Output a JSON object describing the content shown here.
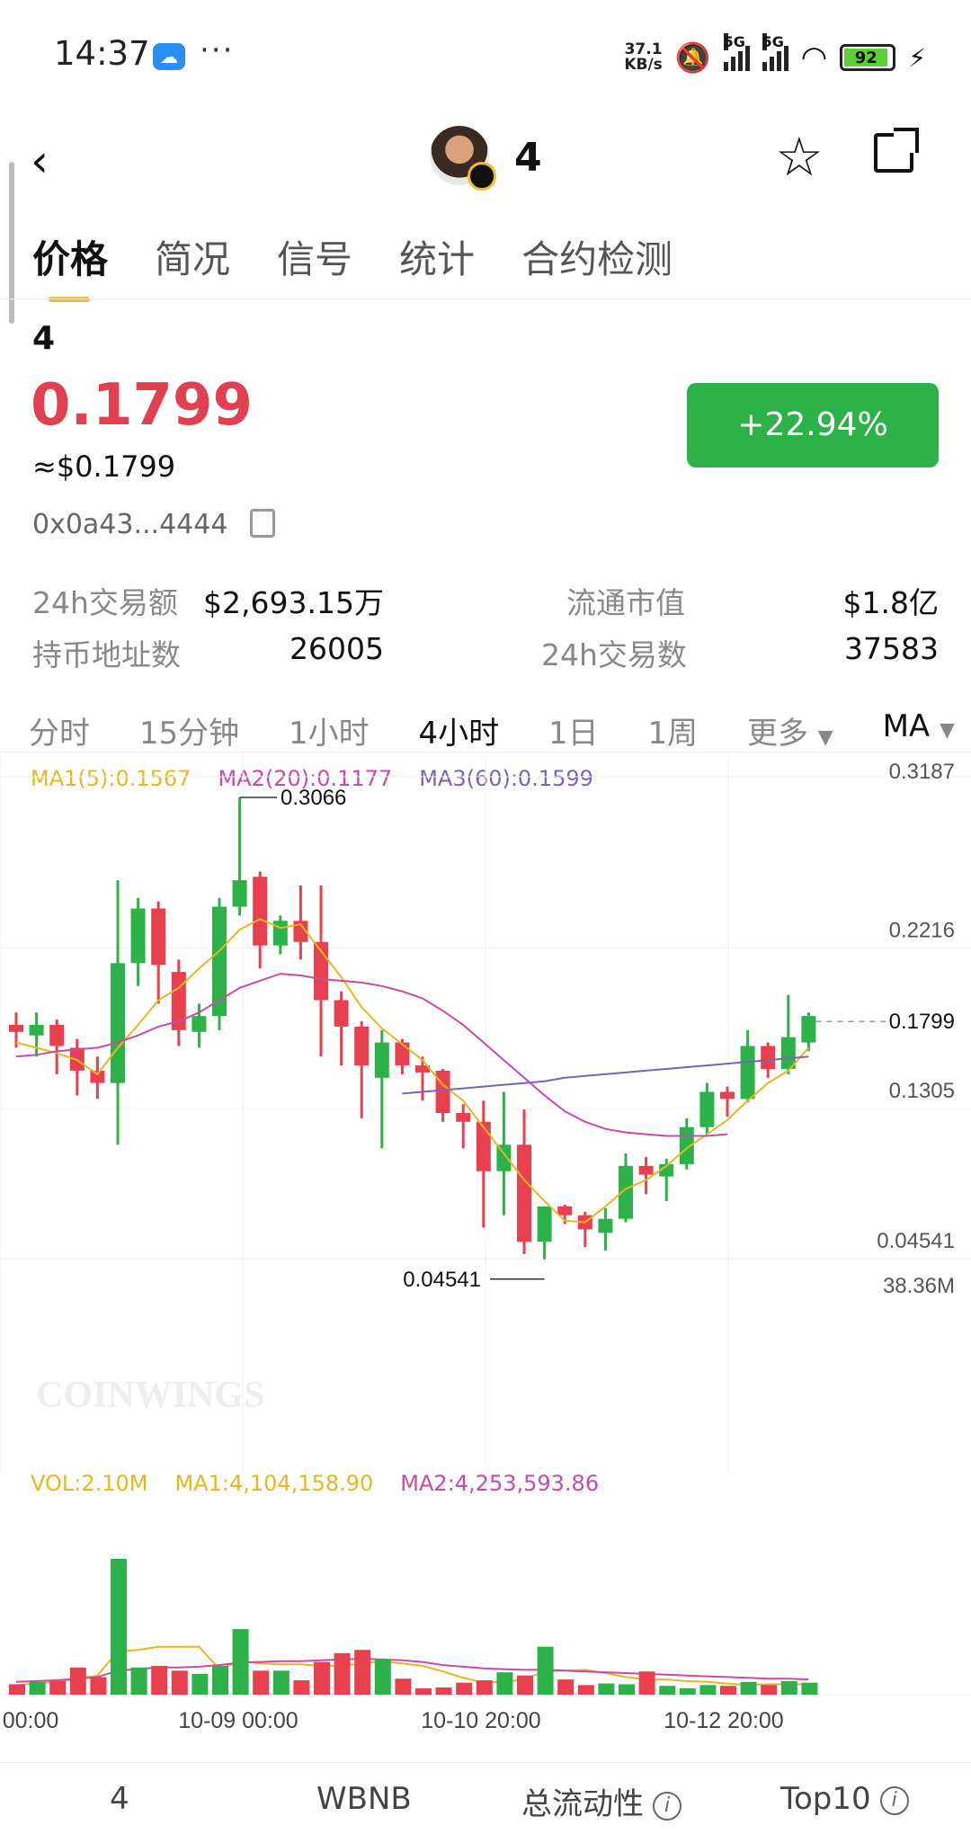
{
  "status_bar": {
    "time": "14:37",
    "speed_value": "37.1",
    "speed_unit": "KB/s",
    "net1": "5G",
    "net2": "5G",
    "battery": "92"
  },
  "header": {
    "title": "4"
  },
  "tabs": [
    "价格",
    "简况",
    "信号",
    "统计",
    "合约检测"
  ],
  "token": {
    "symbol": "4",
    "price": "0.1799",
    "usd_price": "≈$0.1799",
    "change": "+22.94%",
    "address": "0x0a43...4444"
  },
  "stats": {
    "vol24_label": "24h交易额",
    "vol24_value": "$2,693.15万",
    "mcap_label": "流通市值",
    "mcap_value": "$1.8亿",
    "holders_label": "持币地址数",
    "holders_value": "26005",
    "tx24_label": "24h交易数",
    "tx24_value": "37583"
  },
  "timeframes": [
    "分时",
    "15分钟",
    "1小时",
    "4小时",
    "1日",
    "1周",
    "更多",
    "MA"
  ],
  "chart_legend": {
    "ma1": "MA1(5):0.1567",
    "ma2": "MA2(20):0.1177",
    "ma3": "MA3(60):0.1599"
  },
  "vol_legend": {
    "vol": "VOL:2.10M",
    "ma1": "MA1:4,104,158.90",
    "ma2": "MA2:4,253,593.86"
  },
  "watermark": "COINWINGS",
  "colors": {
    "up": "#2db24a",
    "down": "#e8404f",
    "ma1": "#e6b81e",
    "ma2": "#c94aa8",
    "ma3": "#7a62b8",
    "accent": "#f3ba2f"
  },
  "chart_data": {
    "type": "candlestick",
    "y_ticks": [
      "0.3187",
      "0.2216",
      "0.1305",
      "0.04541"
    ],
    "ylim": [
      0.04541,
      0.3187
    ],
    "current_price": "0.1799",
    "high_label": "0.3066",
    "low_label": "0.04541",
    "vol_max_label": "38.36M",
    "x_ticks": [
      "00:00",
      "10-09 00:00",
      "10-10 20:00",
      "10-12 20:00"
    ],
    "candles": [
      {
        "o": 0.178,
        "h": 0.185,
        "l": 0.165,
        "c": 0.174
      },
      {
        "o": 0.172,
        "h": 0.185,
        "l": 0.16,
        "c": 0.178
      },
      {
        "o": 0.178,
        "h": 0.181,
        "l": 0.15,
        "c": 0.166
      },
      {
        "o": 0.165,
        "h": 0.17,
        "l": 0.138,
        "c": 0.152
      },
      {
        "o": 0.152,
        "h": 0.16,
        "l": 0.136,
        "c": 0.145
      },
      {
        "o": 0.145,
        "h": 0.26,
        "l": 0.11,
        "c": 0.213
      },
      {
        "o": 0.213,
        "h": 0.25,
        "l": 0.2,
        "c": 0.244
      },
      {
        "o": 0.244,
        "h": 0.248,
        "l": 0.19,
        "c": 0.212
      },
      {
        "o": 0.208,
        "h": 0.215,
        "l": 0.166,
        "c": 0.175
      },
      {
        "o": 0.174,
        "h": 0.19,
        "l": 0.165,
        "c": 0.183
      },
      {
        "o": 0.183,
        "h": 0.25,
        "l": 0.175,
        "c": 0.245
      },
      {
        "o": 0.245,
        "h": 0.307,
        "l": 0.24,
        "c": 0.26
      },
      {
        "o": 0.262,
        "h": 0.265,
        "l": 0.21,
        "c": 0.223
      },
      {
        "o": 0.223,
        "h": 0.24,
        "l": 0.218,
        "c": 0.237
      },
      {
        "o": 0.237,
        "h": 0.257,
        "l": 0.215,
        "c": 0.225
      },
      {
        "o": 0.225,
        "h": 0.257,
        "l": 0.16,
        "c": 0.192
      },
      {
        "o": 0.192,
        "h": 0.197,
        "l": 0.155,
        "c": 0.177
      },
      {
        "o": 0.177,
        "h": 0.18,
        "l": 0.125,
        "c": 0.155
      },
      {
        "o": 0.148,
        "h": 0.175,
        "l": 0.108,
        "c": 0.168
      },
      {
        "o": 0.168,
        "h": 0.17,
        "l": 0.15,
        "c": 0.155
      },
      {
        "o": 0.155,
        "h": 0.16,
        "l": 0.135,
        "c": 0.151
      },
      {
        "o": 0.152,
        "h": 0.153,
        "l": 0.123,
        "c": 0.128
      },
      {
        "o": 0.128,
        "h": 0.133,
        "l": 0.108,
        "c": 0.123
      },
      {
        "o": 0.123,
        "h": 0.135,
        "l": 0.063,
        "c": 0.095
      },
      {
        "o": 0.095,
        "h": 0.14,
        "l": 0.07,
        "c": 0.11
      },
      {
        "o": 0.11,
        "h": 0.13,
        "l": 0.048,
        "c": 0.055
      },
      {
        "o": 0.055,
        "h": 0.075,
        "l": 0.045,
        "c": 0.075
      },
      {
        "o": 0.075,
        "h": 0.076,
        "l": 0.065,
        "c": 0.07
      },
      {
        "o": 0.07,
        "h": 0.072,
        "l": 0.052,
        "c": 0.062
      },
      {
        "o": 0.06,
        "h": 0.074,
        "l": 0.05,
        "c": 0.068
      },
      {
        "o": 0.068,
        "h": 0.105,
        "l": 0.066,
        "c": 0.098
      },
      {
        "o": 0.098,
        "h": 0.103,
        "l": 0.082,
        "c": 0.093
      },
      {
        "o": 0.092,
        "h": 0.102,
        "l": 0.078,
        "c": 0.099
      },
      {
        "o": 0.099,
        "h": 0.125,
        "l": 0.096,
        "c": 0.12
      },
      {
        "o": 0.12,
        "h": 0.145,
        "l": 0.116,
        "c": 0.14
      },
      {
        "o": 0.14,
        "h": 0.143,
        "l": 0.126,
        "c": 0.136
      },
      {
        "o": 0.136,
        "h": 0.175,
        "l": 0.134,
        "c": 0.166
      },
      {
        "o": 0.166,
        "h": 0.168,
        "l": 0.148,
        "c": 0.153
      },
      {
        "o": 0.153,
        "h": 0.195,
        "l": 0.15,
        "c": 0.171
      },
      {
        "o": 0.168,
        "h": 0.185,
        "l": 0.163,
        "c": 0.183
      }
    ],
    "volumes": [
      1.3,
      1.6,
      1.7,
      3.4,
      2.2,
      17,
      3.4,
      3.6,
      3.0,
      2.6,
      3.6,
      8.2,
      3.0,
      3.0,
      1.8,
      4.1,
      5.2,
      5.6,
      4.4,
      2.0,
      0.8,
      0.9,
      1.5,
      1.8,
      2.8,
      2.4,
      6.0,
      1.9,
      1.2,
      1.4,
      1.3,
      2.9,
      1.1,
      0.8,
      1.2,
      1.1,
      1.6,
      1.2,
      1.7,
      1.5
    ],
    "ma1_line": [
      0.168,
      0.165,
      0.162,
      0.158,
      0.15,
      0.165,
      0.178,
      0.192,
      0.199,
      0.21,
      0.22,
      0.232,
      0.238,
      0.233,
      0.235,
      0.22,
      0.205,
      0.188,
      0.176,
      0.167,
      0.158,
      0.144,
      0.135,
      0.12,
      0.105,
      0.09,
      0.078,
      0.067,
      0.066,
      0.075,
      0.085,
      0.09,
      0.098,
      0.108,
      0.116,
      0.124,
      0.135,
      0.145,
      0.152,
      0.165
    ],
    "ma2_line": [
      0.16,
      0.161,
      0.163,
      0.164,
      0.165,
      0.168,
      0.172,
      0.177,
      0.18,
      0.185,
      0.192,
      0.199,
      0.203,
      0.207,
      0.206,
      0.204,
      0.203,
      0.202,
      0.2,
      0.197,
      0.193,
      0.186,
      0.178,
      0.168,
      0.158,
      0.148,
      0.138,
      0.129,
      0.123,
      0.119,
      0.117,
      0.116,
      0.115,
      0.115,
      0.115,
      0.116
    ],
    "ma3_line": [
      0.139,
      0.14,
      0.141,
      0.142,
      0.143,
      0.144,
      0.145,
      0.146,
      0.148,
      0.149,
      0.15,
      0.151,
      0.152,
      0.153,
      0.154,
      0.155,
      0.156,
      0.157,
      0.158,
      0.159,
      0.16
    ],
    "vol_ma1": [
      1.2,
      1.4,
      1.6,
      2.0,
      2.4,
      5.4,
      5.6,
      6.0,
      6.0,
      6.0,
      3.2,
      4.2,
      3.9,
      3.8,
      3.8,
      3.6,
      3.6,
      3.9,
      4.2,
      3.9,
      3.6,
      2.9,
      2.1,
      1.5,
      1.6,
      1.9,
      2.9,
      3.0,
      3.1,
      2.7,
      2.2,
      1.9,
      1.9,
      1.7,
      1.6,
      1.4,
      1.2,
      1.3,
      1.3,
      1.3
    ],
    "vol_ma2": [
      1.6,
      1.7,
      1.8,
      2.0,
      2.2,
      3.0,
      3.2,
      3.4,
      3.4,
      3.5,
      3.7,
      4.0,
      4.1,
      4.2,
      4.2,
      4.3,
      4.4,
      4.5,
      4.4,
      4.3,
      4.1,
      3.7,
      3.5,
      3.3,
      3.2,
      3.1,
      3.1,
      3.0,
      2.9,
      2.8,
      2.7,
      2.6,
      2.5,
      2.4,
      2.3,
      2.2,
      2.1,
      2.0,
      2.0,
      1.9
    ]
  },
  "bottom_tabs": {
    "t1": "4",
    "t2": "WBNB",
    "t3": "总流动性",
    "t4": "Top10"
  }
}
